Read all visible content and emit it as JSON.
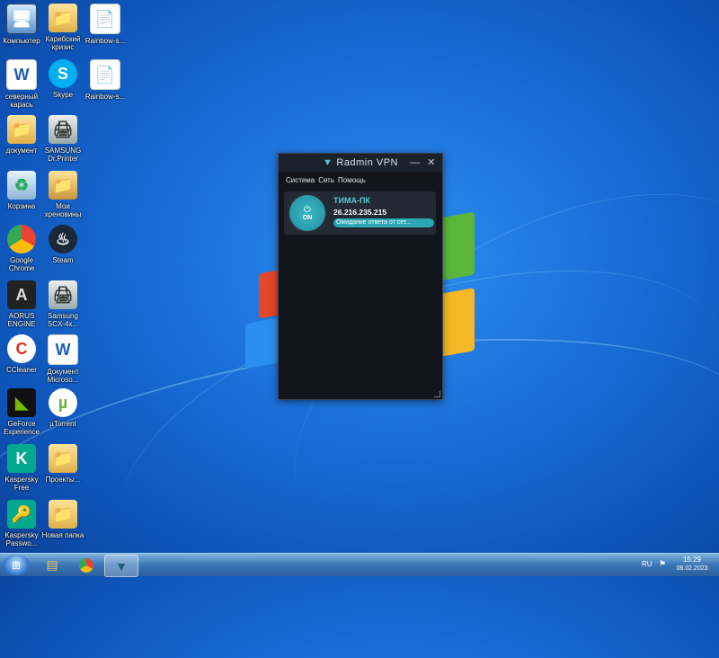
{
  "desktop": {
    "icons": [
      {
        "label": "Компьютер",
        "glyph": "🖥"
      },
      {
        "label": "Карибский кризис",
        "glyph": "📁"
      },
      {
        "label": "Rainbow-s...",
        "glyph": "📄"
      },
      {
        "label": "северный карась",
        "glyph": "W"
      },
      {
        "label": "Skype",
        "glyph": "S"
      },
      {
        "label": "Rainbow-s...",
        "glyph": "📄"
      },
      {
        "label": "документ",
        "glyph": "📁"
      },
      {
        "label": "SAMSUNG Dr.Printer",
        "glyph": "🖨"
      },
      {
        "label": "Корзина",
        "glyph": "♻"
      },
      {
        "label": "Мои хреновины",
        "glyph": "📁"
      },
      {
        "label": "Google Chrome",
        "glyph": "●"
      },
      {
        "label": "Steam",
        "glyph": "♨"
      },
      {
        "label": "AORUS ENGINE",
        "glyph": "A"
      },
      {
        "label": "Samsung SCX-4x...",
        "glyph": "🖨"
      },
      {
        "label": "CCleaner",
        "glyph": "C"
      },
      {
        "label": "Документ Microso...",
        "glyph": "W"
      },
      {
        "label": "GeForce Experience",
        "glyph": "◣"
      },
      {
        "label": "µTorrent",
        "glyph": "µ"
      },
      {
        "label": "Kaspersky Free",
        "glyph": "K"
      },
      {
        "label": "Проекты...",
        "glyph": "📁"
      },
      {
        "label": "Kaspersky Passwo...",
        "glyph": "🔑"
      },
      {
        "label": "Новая папка",
        "glyph": "📁"
      }
    ]
  },
  "radmin": {
    "title": "Radmin VPN",
    "menu": [
      "Система",
      "Сеть",
      "Помощь"
    ],
    "network": {
      "name": "ТИМА-ПК",
      "ip": "26.216.235.215",
      "status": "Ожидание ответа от сет...",
      "power_label": "ON"
    }
  },
  "taskbar": {
    "language": "RU",
    "time": "15:29",
    "date": "08.02.2023"
  },
  "colors": {
    "accent": "#2aa7b5",
    "window_bg": "#12151c",
    "taskbar": "#3a76b6"
  }
}
